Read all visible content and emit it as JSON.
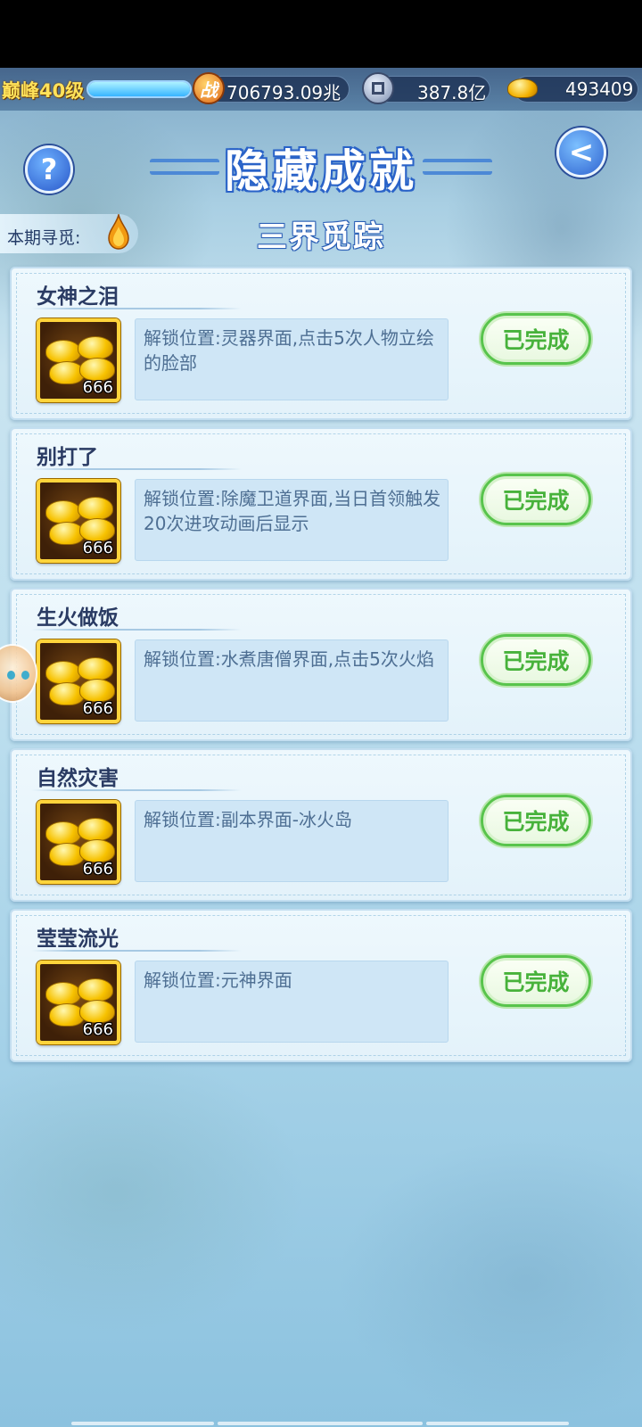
{
  "topbar": {
    "level": "巅峰40级",
    "xp_fraction": 1.0,
    "combat_power": "706793.09兆",
    "silver": "387.8亿",
    "gold": "493409"
  },
  "header": {
    "title": "隐藏成就",
    "subtitle": "三界觅踪",
    "seek_label": "本期寻觅:",
    "help_glyph": "?",
    "back_glyph": "<"
  },
  "achievements": [
    {
      "title": "女神之泪",
      "reward_count": "666",
      "desc": "解锁位置:灵器界面,点击5次人物立绘的脸部",
      "status": "已完成"
    },
    {
      "title": "别打了",
      "reward_count": "666",
      "desc": "解锁位置:除魔卫道界面,当日首领触发20次进攻动画后显示",
      "status": "已完成"
    },
    {
      "title": "生火做饭",
      "reward_count": "666",
      "desc": "解锁位置:水煮唐僧界面,点击5次火焰",
      "status": "已完成"
    },
    {
      "title": "自然灾害",
      "reward_count": "666",
      "desc": "解锁位置:副本界面-冰火岛",
      "status": "已完成"
    },
    {
      "title": "莹莹流光",
      "reward_count": "666",
      "desc": "解锁位置:元神界面",
      "status": "已完成"
    }
  ],
  "colors": {
    "accent": "#2f63d0",
    "done_green": "#47b23b",
    "gold": "#ffd43b"
  }
}
